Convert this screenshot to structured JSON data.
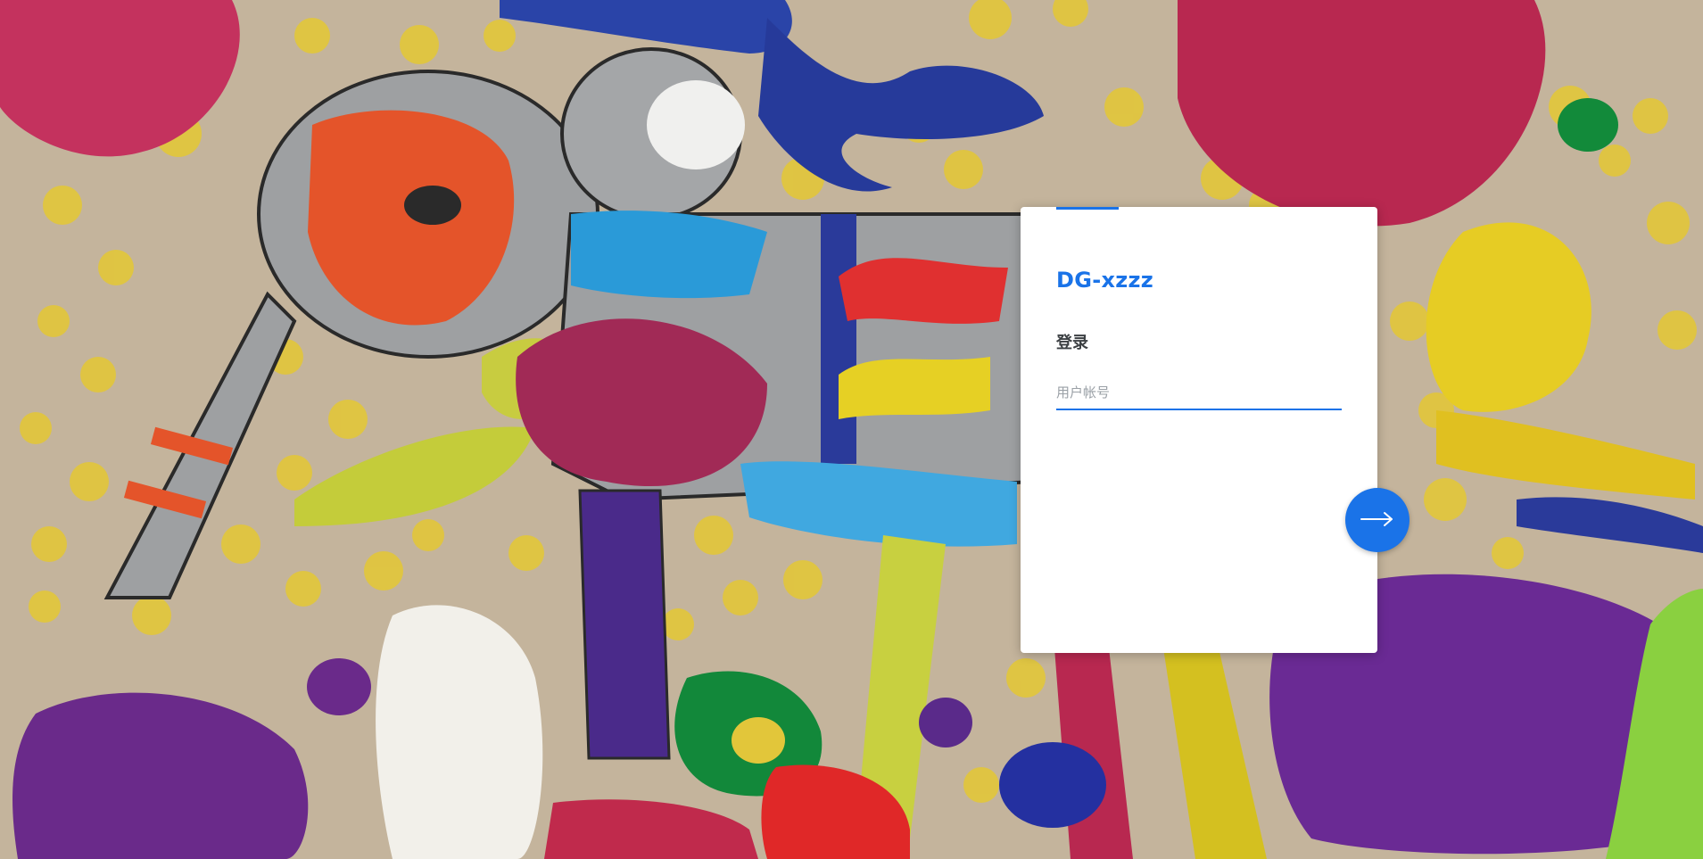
{
  "login": {
    "brand": "DG-xzzz",
    "heading": "登录",
    "username_placeholder": "用户帐号",
    "username_value": "",
    "next_icon": "arrow-right-icon"
  },
  "colors": {
    "accent": "#1a73e8",
    "card": "#ffffff",
    "heading_text": "#3c4043",
    "placeholder": "#9aa0a6"
  },
  "background": {
    "description_icon": "childrens-painting-background"
  }
}
